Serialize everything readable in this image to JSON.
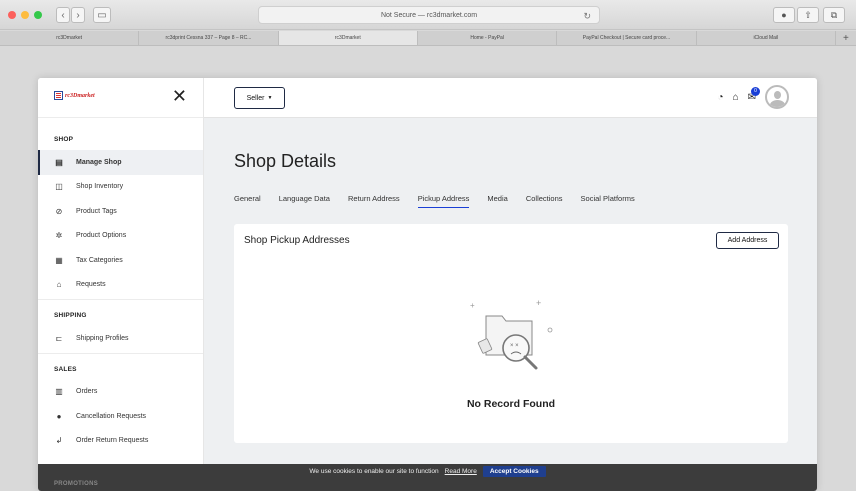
{
  "browser": {
    "url": "Not Secure — rc3dmarket.com",
    "tabs": [
      {
        "label": "rc3Dmarket",
        "active": false
      },
      {
        "label": "rc3dprint Cessna 337 – Page 8 – RC...",
        "active": false
      },
      {
        "label": "rc3Dmarket",
        "active": true
      },
      {
        "label": "Home - PayPal",
        "active": false
      },
      {
        "label": "PayPal Checkout | Secure card proce...",
        "active": false
      },
      {
        "label": "iCloud Mail",
        "active": false
      }
    ],
    "add_tab": "+"
  },
  "sidebar": {
    "logo_text": "rc3Dmarket",
    "close": "✕",
    "sections": [
      {
        "title": "SHOP",
        "items": [
          {
            "label": "Manage Shop",
            "icon": "▤",
            "active": true
          },
          {
            "label": "Shop Inventory",
            "icon": "◫",
            "active": false
          },
          {
            "label": "Product Tags",
            "icon": "⊘",
            "active": false
          },
          {
            "label": "Product Options",
            "icon": "✲",
            "active": false
          },
          {
            "label": "Tax Categories",
            "icon": "▦",
            "active": false
          },
          {
            "label": "Requests",
            "icon": "⌂",
            "active": false
          }
        ]
      },
      {
        "title": "SHIPPING",
        "items": [
          {
            "label": "Shipping Profiles",
            "icon": "⊏",
            "active": false
          }
        ]
      },
      {
        "title": "SALES",
        "items": [
          {
            "label": "Orders",
            "icon": "▥",
            "active": false
          },
          {
            "label": "Cancellation Requests",
            "icon": "●",
            "active": false
          },
          {
            "label": "Order Return Requests",
            "icon": "↲",
            "active": false
          }
        ]
      }
    ]
  },
  "topbar": {
    "seller_label": "Seller",
    "notification_count": "0"
  },
  "main": {
    "title": "Shop Details",
    "tabs": [
      {
        "label": "General",
        "active": false
      },
      {
        "label": "Language Data",
        "active": false
      },
      {
        "label": "Return Address",
        "active": false
      },
      {
        "label": "Pickup Address",
        "active": true
      },
      {
        "label": "Media",
        "active": false
      },
      {
        "label": "Collections",
        "active": false
      },
      {
        "label": "Social Platforms",
        "active": false
      }
    ],
    "card_title": "Shop Pickup Addresses",
    "add_button": "Add Address",
    "empty_text": "No Record Found"
  },
  "cookie": {
    "text": "We use cookies to enable our site to function",
    "link": "Read More",
    "accept": "Accept Cookies",
    "under_text": "PROMOTIONS"
  },
  "colors": {
    "accent": "#1a3fd6",
    "nav_dark": "#1f2a44",
    "cookie_bg": "#3c3c3c"
  }
}
